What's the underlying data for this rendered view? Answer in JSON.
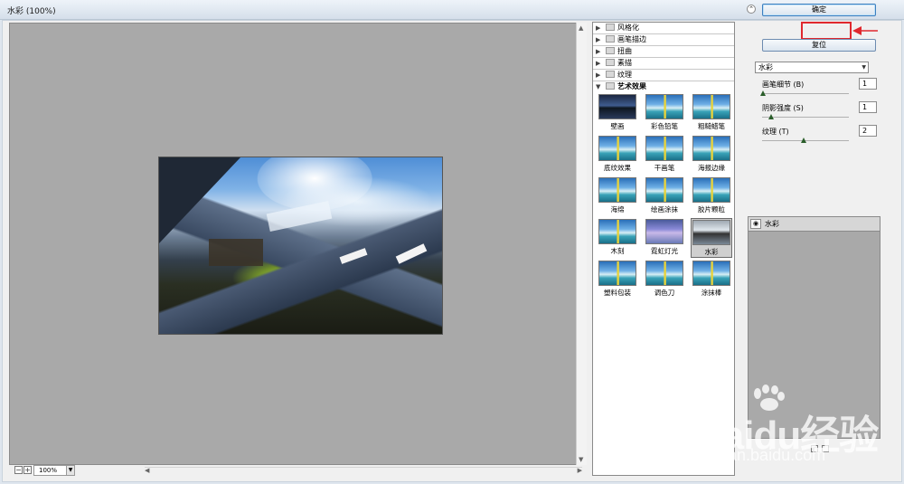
{
  "window": {
    "title": "水彩 (100%)"
  },
  "preview": {
    "zoom": "100%",
    "zoom_out_icon": "minus-icon",
    "zoom_in_icon": "plus-icon"
  },
  "categories": [
    {
      "label": "风格化",
      "expanded": false
    },
    {
      "label": "画笔描边",
      "expanded": false
    },
    {
      "label": "扭曲",
      "expanded": false
    },
    {
      "label": "素描",
      "expanded": false
    },
    {
      "label": "纹理",
      "expanded": false
    },
    {
      "label": "艺术效果",
      "expanded": true
    }
  ],
  "filters": [
    {
      "label": "壁画",
      "style": "dark"
    },
    {
      "label": "彩色铅笔",
      "style": "normal"
    },
    {
      "label": "粗糙蜡笔",
      "style": "normal"
    },
    {
      "label": "底纹效果",
      "style": "normal"
    },
    {
      "label": "干画笔",
      "style": "normal"
    },
    {
      "label": "海报边缘",
      "style": "normal"
    },
    {
      "label": "海绵",
      "style": "normal"
    },
    {
      "label": "绘画涂抹",
      "style": "normal"
    },
    {
      "label": "胶片颗粒",
      "style": "normal"
    },
    {
      "label": "木刻",
      "style": "normal"
    },
    {
      "label": "霓虹灯光",
      "style": "glow"
    },
    {
      "label": "水彩",
      "style": "selected"
    },
    {
      "label": "塑料包装",
      "style": "normal"
    },
    {
      "label": "调色刀",
      "style": "normal"
    },
    {
      "label": "涂抹棒",
      "style": "normal"
    }
  ],
  "buttons": {
    "ok_label": "确定",
    "reset_label": "复位"
  },
  "filter_select": {
    "value": "水彩"
  },
  "params": [
    {
      "label": "画笔细节 (B)",
      "value": "1",
      "level": 0.0
    },
    {
      "label": "阴影强度 (S)",
      "value": "1",
      "level": 0.1
    },
    {
      "label": "纹理 (T)",
      "value": "2",
      "level": 0.5
    }
  ],
  "layer": {
    "name": "水彩"
  },
  "watermark": {
    "logo": "Baidu经验",
    "url": "jingyan.baidu.com"
  },
  "colors": {
    "highlight": "#e0282e",
    "selected_thumb": "#cfcfcf",
    "preview_bg": "#a9a9a9"
  }
}
